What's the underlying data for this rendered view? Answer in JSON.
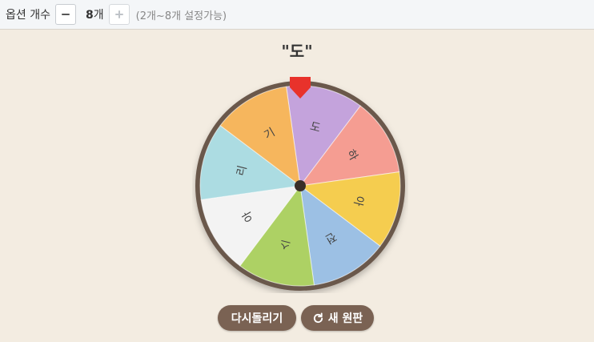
{
  "options": {
    "label": "옵션 개수",
    "count_number": "8",
    "count_unit": "개",
    "hint": "(2개~8개 설정가능)"
  },
  "result": "\"도\"",
  "wheel": {
    "segments": [
      {
        "label": "도",
        "color": "#c4a3dc"
      },
      {
        "label": "하",
        "color": "#f59d92"
      },
      {
        "label": "아",
        "color": "#f5cd4f"
      },
      {
        "label": "전",
        "color": "#9cc0e4"
      },
      {
        "label": "스",
        "color": "#add164"
      },
      {
        "label": "아",
        "color": "#f3f3f3"
      },
      {
        "label": "리",
        "color": "#acdce2"
      },
      {
        "label": "기",
        "color": "#f6b65d"
      }
    ],
    "rim_color": "#6a584b",
    "pointer_color": "#e8322b"
  },
  "buttons": {
    "again": "다시돌리기",
    "new": "새 원판"
  }
}
